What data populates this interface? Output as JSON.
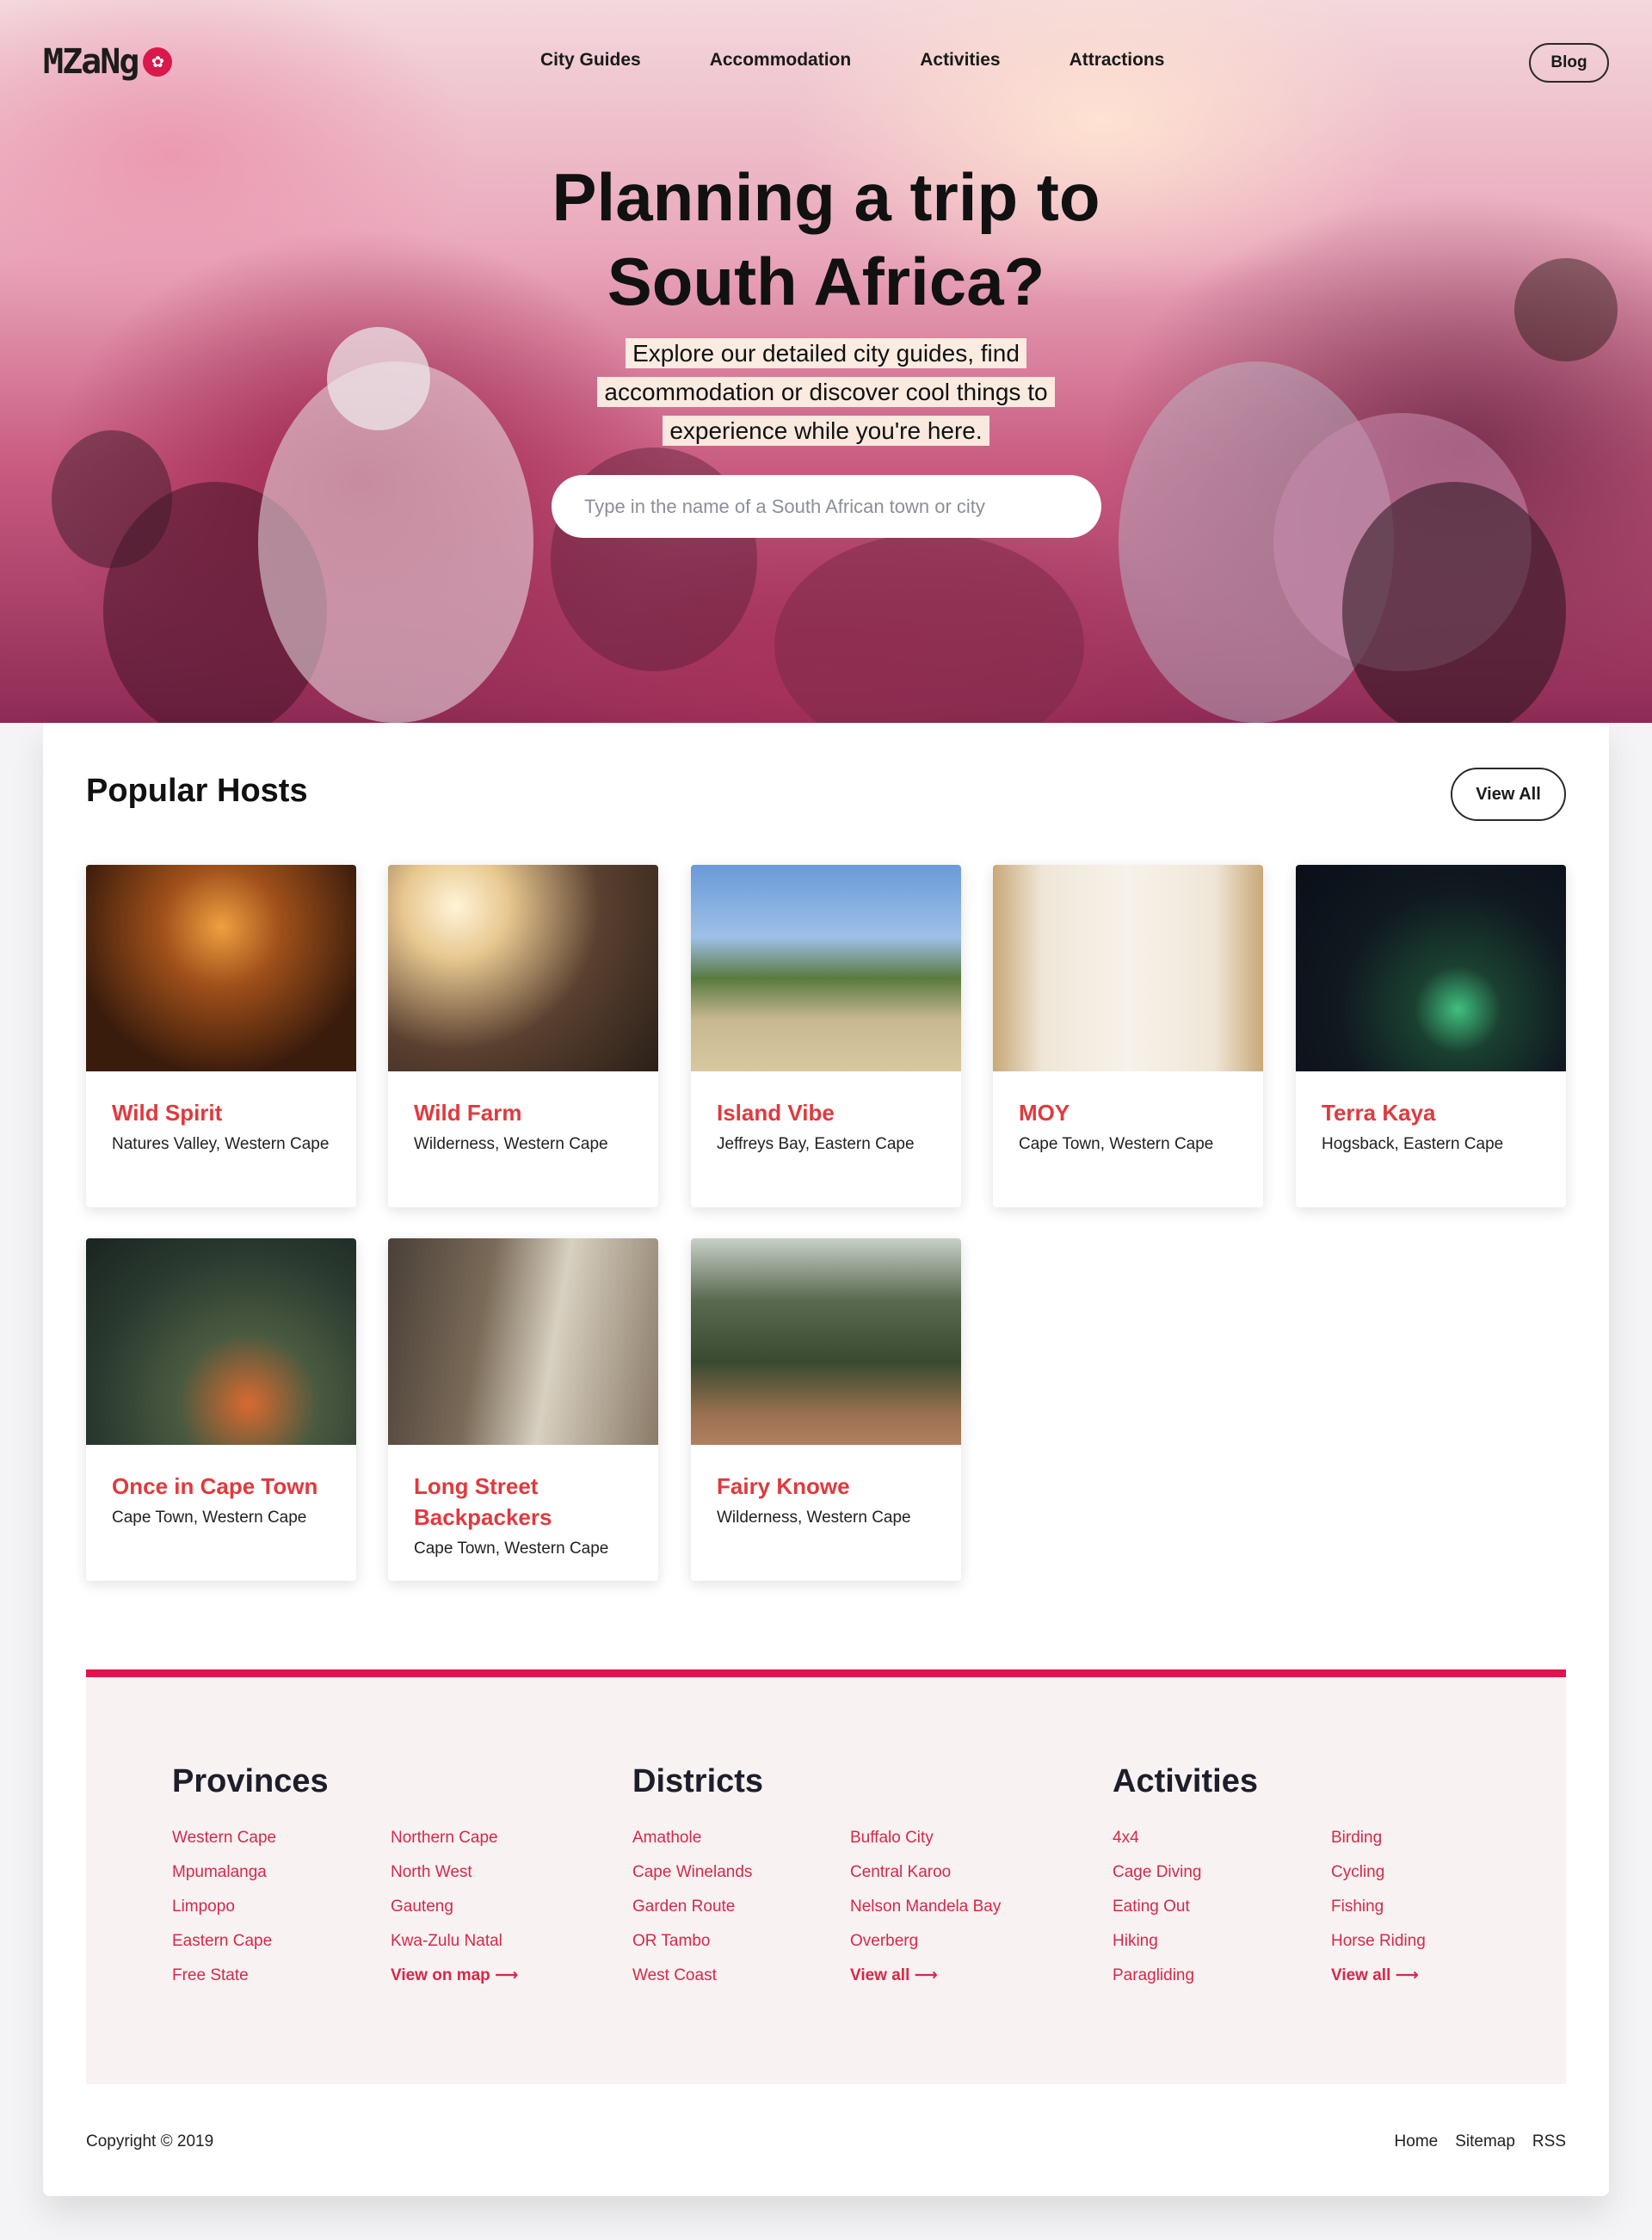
{
  "brand": {
    "logo_text": "MZaNg",
    "logo_glyph": "✿",
    "accent": "#e0134d",
    "host_name_color": "#e03a3e"
  },
  "nav": {
    "links": [
      "City Guides",
      "Accommodation",
      "Activities",
      "Attractions"
    ],
    "blog_label": "Blog"
  },
  "hero": {
    "title_line1": "Planning a trip to",
    "title_line2": "South Africa?",
    "subtitle": "Explore our detailed city guides, find accommodation or discover cool things to experience while you're here.",
    "search_placeholder": "Type in the name of a South African town or city"
  },
  "popular_hosts": {
    "title": "Popular Hosts",
    "view_all_label": "View All",
    "hosts": [
      {
        "name": "Wild Spirit",
        "location": "Natures Valley, Western Cape"
      },
      {
        "name": "Wild Farm",
        "location": "Wilderness, Western Cape"
      },
      {
        "name": "Island Vibe",
        "location": "Jeffreys Bay, Eastern Cape"
      },
      {
        "name": "MOY",
        "location": "Cape Town, Western Cape"
      },
      {
        "name": "Terra Kaya",
        "location": "Hogsback, Eastern Cape"
      },
      {
        "name": "Once in Cape Town",
        "location": "Cape Town, Western Cape"
      },
      {
        "name": "Long Street Backpackers",
        "location": "Cape Town, Western Cape"
      },
      {
        "name": "Fairy Knowe",
        "location": "Wilderness, Western Cape"
      }
    ]
  },
  "footer": {
    "provinces": {
      "title": "Provinces",
      "col1": [
        "Western Cape",
        "Mpumalanga",
        "Limpopo",
        "Eastern Cape",
        "Free State"
      ],
      "col2": [
        "Northern Cape",
        "North West",
        "Gauteng",
        "Kwa-Zulu Natal"
      ],
      "more": "View on map ⟶"
    },
    "districts": {
      "title": "Districts",
      "col1": [
        "Amathole",
        "Cape Winelands",
        "Garden Route",
        "OR Tambo",
        "West Coast"
      ],
      "col2": [
        "Buffalo City",
        "Central Karoo",
        "Nelson Mandela Bay",
        "Overberg"
      ],
      "more": "View all ⟶"
    },
    "activities": {
      "title": "Activities",
      "col1": [
        "4x4",
        "Cage Diving",
        "Eating Out",
        "Hiking",
        "Paragliding"
      ],
      "col2": [
        "Birding",
        "Cycling",
        "Fishing",
        "Horse Riding"
      ],
      "more": "View all ⟶"
    },
    "copyright": "Copyright © 2019",
    "bottom_links": [
      "Home",
      "Sitemap",
      "RSS"
    ]
  }
}
